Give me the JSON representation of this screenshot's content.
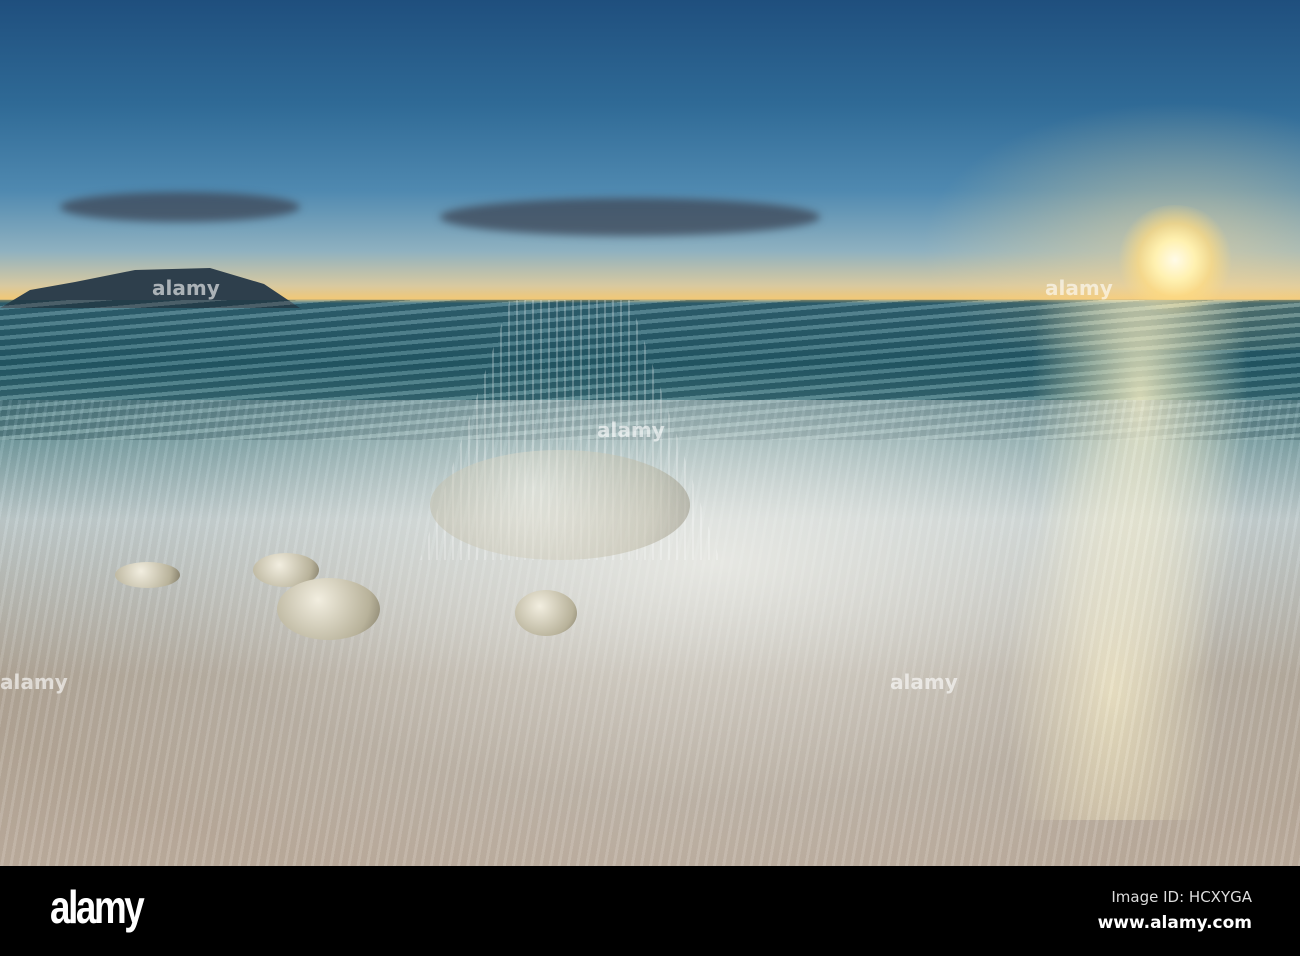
{
  "photo": {
    "description_free": true
  },
  "footer": {
    "logo": "alamy",
    "image_id": "Image ID: HCXYGA",
    "url": "www.alamy.com"
  },
  "watermark": "alamy"
}
